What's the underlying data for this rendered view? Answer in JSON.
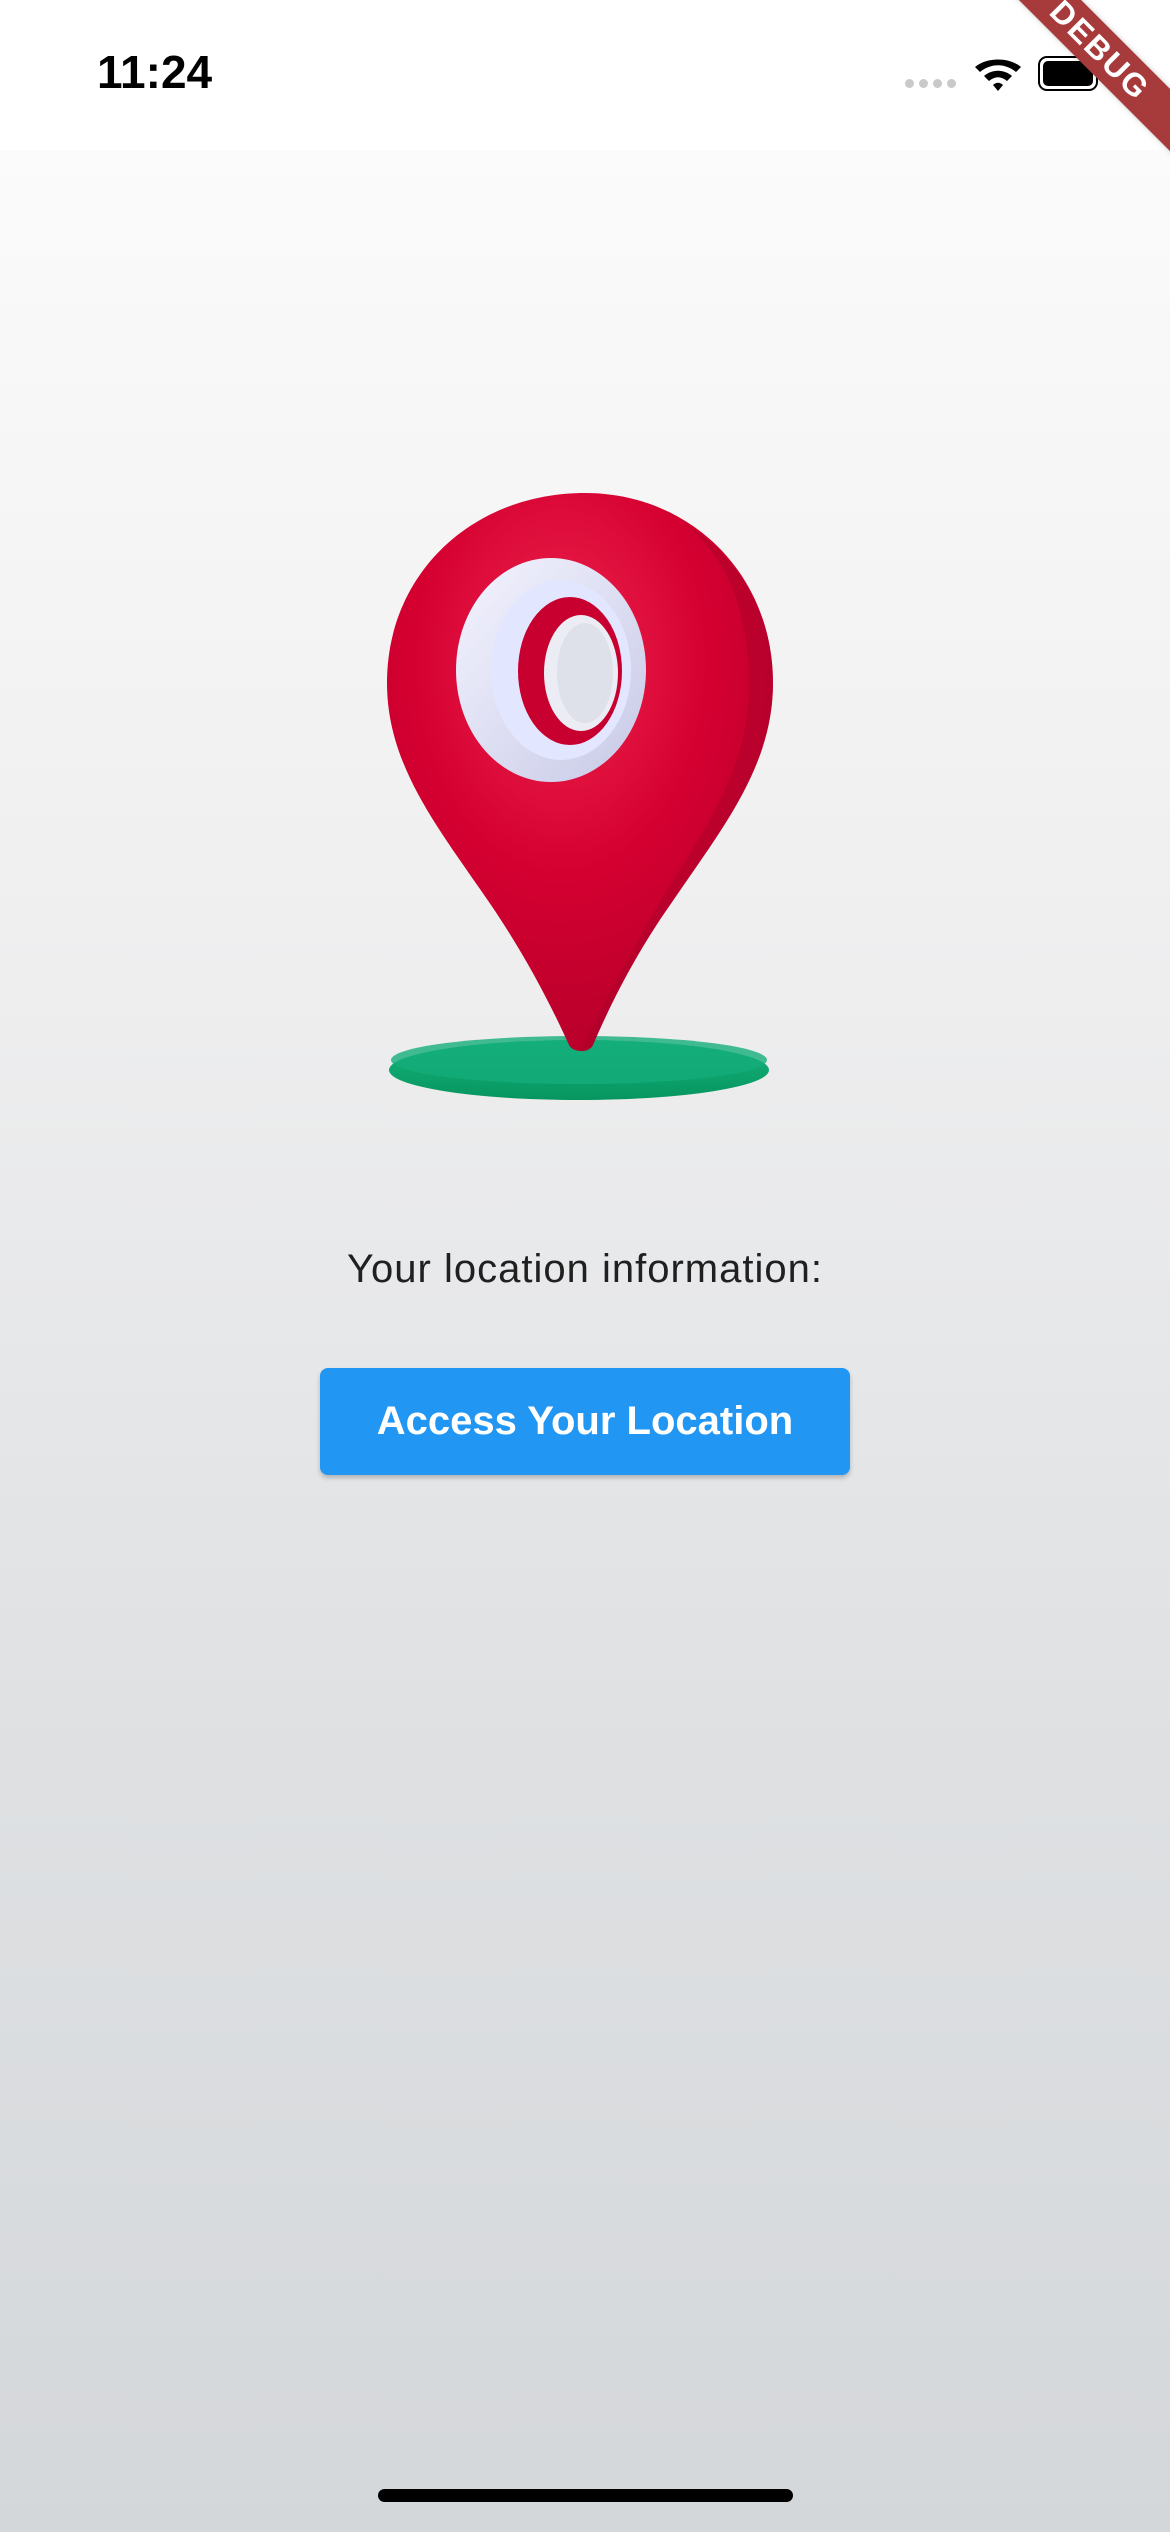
{
  "status_bar": {
    "time": "11:24"
  },
  "debug_banner": {
    "label": "DEBUG"
  },
  "main": {
    "illustration": "location-pin-icon",
    "location_label": "Your location information:",
    "button_label": "Access Your Location"
  },
  "colors": {
    "button": "#2196f3",
    "pin": "#d80030",
    "pin_base": "#0aa36f",
    "debug_ribbon": "#a73b3b"
  }
}
